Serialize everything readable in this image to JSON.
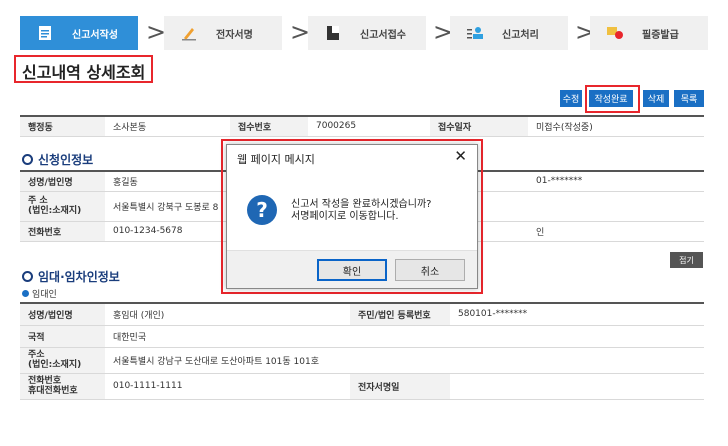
{
  "steps": [
    {
      "label": "신고서작성",
      "icon": "document-icon",
      "active": true
    },
    {
      "label": "전자서명",
      "icon": "pen-icon",
      "active": false
    },
    {
      "label": "신고서접수",
      "icon": "folder-icon",
      "active": false
    },
    {
      "label": "신고처리",
      "icon": "person-list-icon",
      "active": false
    },
    {
      "label": "필증발급",
      "icon": "certificate-icon",
      "active": false
    }
  ],
  "page_title": "신고내역 상세조회",
  "actions": {
    "edit": "수정",
    "complete": "작성완료",
    "delete": "삭제",
    "list": "목록"
  },
  "summary": {
    "district_label": "행정동",
    "district_value": "소사본동",
    "receipt_no_label": "접수번호",
    "receipt_no_value": "7000265",
    "receipt_date_label": "접수일자",
    "receipt_date_value": "미접수(작성중)"
  },
  "applicant": {
    "title": "신청인정보",
    "name_label": "성명/법인명",
    "name_value": "홍길동",
    "address_label_1": "주 소",
    "address_label_2": "(법인:소재지)",
    "address_value": "서울특별시 강북구 도봉로 8",
    "phone_label": "전화번호",
    "phone_value": "010-1234-5678",
    "id_partial": "01-*******",
    "extra_partial": "인"
  },
  "lease": {
    "title": "임대·임차인정보",
    "subtitle": "임대인",
    "fold_label": "접기",
    "name_label": "성명/법인명",
    "name_value": "홍임대 (개인)",
    "reg_label": "주민/법인 등록번호",
    "reg_value": "580101-*******",
    "nation_label": "국적",
    "nation_value": "대한민국",
    "address_label_1": "주소",
    "address_label_2": "(법인:소재지)",
    "address_value": "서울특별시 강남구 도산대로 도산아파트 101동 101호",
    "phone_label_1": "전화번호",
    "phone_label_2": "휴대전화번호",
    "phone_value": "010-1111-1111",
    "esign_label": "전자서명일",
    "esign_value": ""
  },
  "dialog": {
    "title": "웹 페이지 메시지",
    "line1": "신고서 작성을 완료하시겠습니까?",
    "line2": "서명페이지로 이동합니다.",
    "ok": "확인",
    "cancel": "취소"
  },
  "colors": {
    "active_step": "#2f8fd8",
    "button": "#1a6fc4",
    "highlight": "#e8262c",
    "section": "#1a3d7c"
  }
}
